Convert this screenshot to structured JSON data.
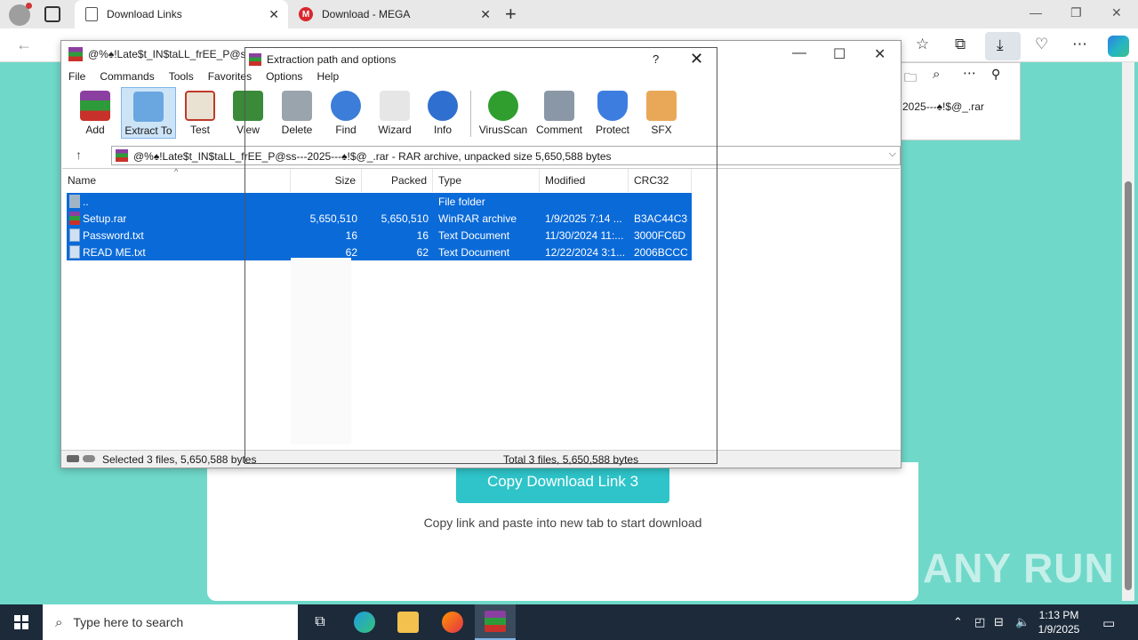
{
  "browser": {
    "tabs": [
      {
        "label": "Download Links",
        "active": true
      },
      {
        "label": "Download - MEGA",
        "active": false
      }
    ],
    "mega_glyph": "M"
  },
  "page": {
    "copy_button": "Copy Download Link 3",
    "caption": "Copy link and paste into new tab to start download",
    "watermark": "ANY RUN",
    "download_popup_file": "2025---♠!$@_.rar"
  },
  "winrar": {
    "title": "@%♠!Late$t_IN$taLL_frEE_P@ss---",
    "menu": [
      "File",
      "Commands",
      "Tools",
      "Favorites",
      "Options",
      "Help"
    ],
    "toolbar": [
      {
        "label": "Add",
        "icon": "add-archive-icon"
      },
      {
        "label": "Extract To",
        "icon": "extract-folder-icon"
      },
      {
        "label": "Test",
        "icon": "test-clipboard-icon"
      },
      {
        "label": "View",
        "icon": "view-book-icon"
      },
      {
        "label": "Delete",
        "icon": "delete-bin-icon"
      },
      {
        "label": "Find",
        "icon": "find-magnifier-icon"
      },
      {
        "label": "Wizard",
        "icon": "wizard-wand-icon"
      },
      {
        "label": "Info",
        "icon": "info-icon"
      },
      {
        "label": "VirusScan",
        "icon": "virus-scan-icon"
      },
      {
        "label": "Comment",
        "icon": "comment-icon"
      },
      {
        "label": "Protect",
        "icon": "protect-shield-icon"
      },
      {
        "label": "SFX",
        "icon": "sfx-box-icon"
      }
    ],
    "path": "@%♠!Late$t_IN$taLL_frEE_P@ss---2025---♠!$@_.rar - RAR archive, unpacked size 5,650,588 bytes",
    "columns": [
      "Name",
      "Size",
      "Packed",
      "Type",
      "Modified",
      "CRC32"
    ],
    "rows": [
      {
        "name": "..",
        "size": "",
        "packed": "",
        "type": "File folder",
        "modified": "",
        "crc": "",
        "icon": "folder"
      },
      {
        "name": "Setup.rar",
        "size": "5,650,510",
        "packed": "5,650,510",
        "type": "WinRAR archive",
        "modified": "1/9/2025 7:14 ...",
        "crc": "B3AC44C3",
        "icon": "rar"
      },
      {
        "name": "Password.txt",
        "size": "16",
        "packed": "16",
        "type": "Text Document",
        "modified": "11/30/2024 11:...",
        "crc": "3000FC6D",
        "icon": "txt"
      },
      {
        "name": "READ ME.txt",
        "size": "62",
        "packed": "62",
        "type": "Text Document",
        "modified": "12/22/2024 3:1...",
        "crc": "2006BCCC",
        "icon": "txt"
      }
    ],
    "status_left": "Selected 3 files, 5,650,588 bytes",
    "status_right": "Total 3 files, 5,650,588 bytes"
  },
  "dialog": {
    "title": "Extraction path and options",
    "help": "?",
    "close": "✕"
  },
  "taskbar": {
    "search_placeholder": "Type here to search",
    "time": "1:13 PM",
    "date": "1/9/2025"
  }
}
